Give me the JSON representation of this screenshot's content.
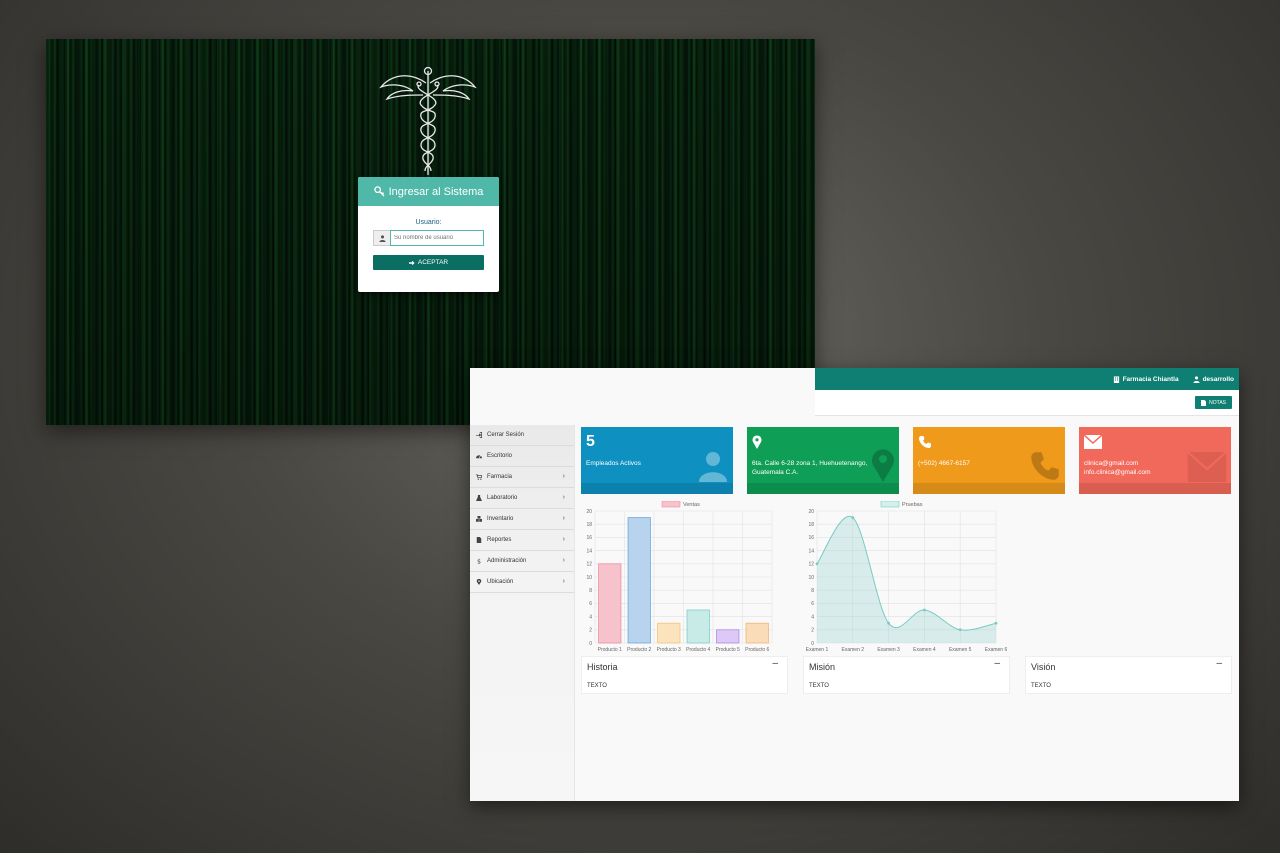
{
  "login": {
    "header_title": "Ingresar al Sistema",
    "user_label": "Usuario:",
    "user_placeholder": "Su nombre de usuario",
    "accept_label": "ACEPTAR"
  },
  "topbar": {
    "pharmacy": "Farmacia Chiantla",
    "user": "desarrollo"
  },
  "subbar": {
    "notes_label": "NOTAS"
  },
  "sidebar": {
    "items": [
      {
        "label": "Cerrar Sesión",
        "icon": "logout-icon",
        "chevron": ""
      },
      {
        "label": "Escritorio",
        "icon": "dashboard-icon",
        "chevron": ""
      },
      {
        "label": "Farmacia",
        "icon": "cart-icon",
        "chevron": "›"
      },
      {
        "label": "Laboratorio",
        "icon": "flask-icon",
        "chevron": "›"
      },
      {
        "label": "Inventario",
        "icon": "cubes-icon",
        "chevron": "›"
      },
      {
        "label": "Reportes",
        "icon": "file-icon",
        "chevron": "›"
      },
      {
        "label": "Administración",
        "icon": "dollar-icon",
        "chevron": "›"
      },
      {
        "label": "Ubicación",
        "icon": "map-marker-icon",
        "chevron": "›"
      }
    ]
  },
  "cards": {
    "employees": {
      "value": "5",
      "text": "Empleados Activos",
      "color": "#0e90c1"
    },
    "address": {
      "text1": "6ta. Calle 6-28 zona 1, Huehuetenango,",
      "text2": "Guatemala C.A.",
      "color": "#0f9e55"
    },
    "phone": {
      "text": "(+502) 4667-6157",
      "color": "#ef9a1a"
    },
    "email": {
      "text1": "clinica@gmail.com",
      "text2": "info.clinica@gmail.com",
      "color": "#f1695a"
    }
  },
  "chart_data": [
    {
      "type": "bar",
      "legend": "Ventas",
      "categories": [
        "Producto 1",
        "Producto 2",
        "Producto 3",
        "Producto 4",
        "Producto 5",
        "Producto 6"
      ],
      "values": [
        12,
        19,
        3,
        5,
        2,
        3
      ],
      "colors": [
        "#f6c2cb",
        "#b7d3ee",
        "#fbe3bd",
        "#c9ebe8",
        "#dcc9f6",
        "#fbdcb8"
      ],
      "borders": [
        "#ef8ea0",
        "#6ea8dc",
        "#f3c47a",
        "#7fcfc8",
        "#a98ae8",
        "#f3b57a"
      ],
      "ylim": [
        0,
        20
      ],
      "yticks": [
        0,
        2,
        4,
        6,
        8,
        10,
        12,
        14,
        16,
        18,
        20
      ]
    },
    {
      "type": "line",
      "legend": "Pruebas",
      "categories": [
        "Examen 1",
        "Examen 2",
        "Examen 3",
        "Examen 4",
        "Examen 5",
        "Examen 6"
      ],
      "values": [
        12,
        19,
        3,
        5,
        2,
        3
      ],
      "color": "#78cbc4",
      "ylim": [
        0,
        20
      ],
      "yticks": [
        0,
        2,
        4,
        6,
        8,
        10,
        12,
        14,
        16,
        18,
        20
      ]
    }
  ],
  "panels": {
    "historia": {
      "title": "Historia",
      "body": "TEXTO"
    },
    "mision": {
      "title": "Misión",
      "body": "TEXTO"
    },
    "vision": {
      "title": "Visión",
      "body": "TEXTO"
    }
  }
}
